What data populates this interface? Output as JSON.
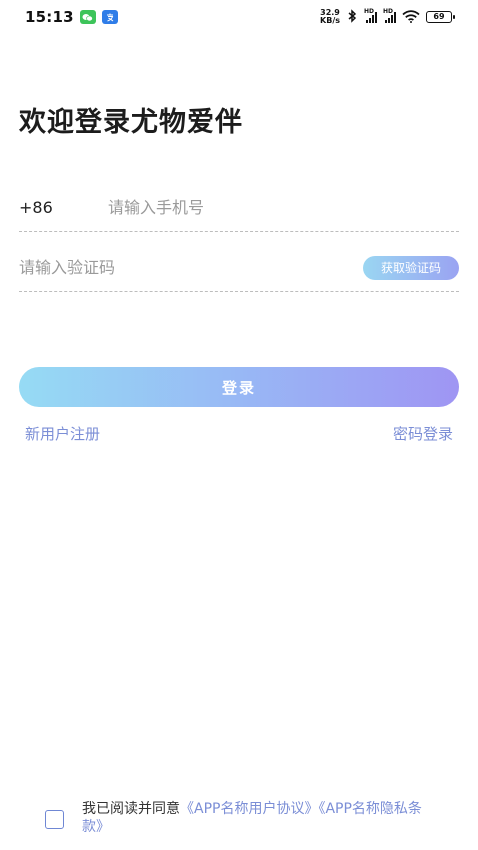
{
  "status_bar": {
    "time": "15:13",
    "app_badges": [
      {
        "icon": "wechat-icon",
        "color": "#3dc45a"
      },
      {
        "icon": "alipay-icon",
        "color": "#2f7de8"
      }
    ],
    "net_speed_value": "32.9",
    "net_speed_unit": "KB/s",
    "signal_label_1": "HD",
    "signal_label_2": "HD",
    "battery": "69"
  },
  "login": {
    "title": "欢迎登录尤物爱伴",
    "country_code": "+86",
    "phone_placeholder": "请输入手机号",
    "code_placeholder": "请输入验证码",
    "get_code_label": "获取验证码",
    "login_label": "登录",
    "register_link": "新用户注册",
    "password_login_link": "密码登录"
  },
  "agreement": {
    "prefix": "我已阅读并同意",
    "user_agreement": "《APP名称用户协议》",
    "privacy_policy": "《APP名称隐私条款》"
  },
  "colors": {
    "accent": "#7b8ed6",
    "gradient_start": "#96dbf4",
    "gradient_end": "#9f95f3"
  }
}
